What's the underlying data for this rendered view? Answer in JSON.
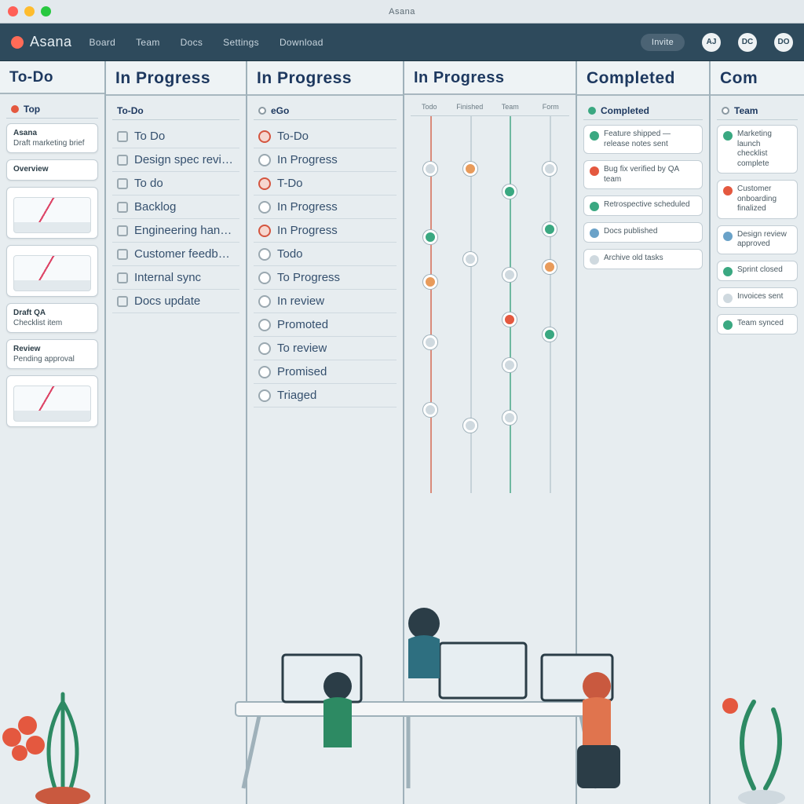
{
  "mac": {
    "title": "Asana"
  },
  "header": {
    "brand": "Asana",
    "nav": [
      "Board",
      "Team",
      "Docs",
      "Settings",
      "Download"
    ],
    "primary_btn": "Invite",
    "circles": [
      "AJ",
      "DC",
      "DO"
    ]
  },
  "columns": [
    {
      "title": "To-Do",
      "section": "Top",
      "cards": [
        {
          "title": "Asana",
          "sub": "Draft marketing brief"
        },
        {
          "title": "Overview",
          "sub": ""
        },
        {
          "title": "",
          "sub": "",
          "thumb": "line"
        },
        {
          "title": "",
          "sub": "",
          "thumb": "line"
        },
        {
          "title": "Draft QA",
          "sub": "Checklist item"
        },
        {
          "title": "Review",
          "sub": "Pending approval"
        },
        {
          "title": "",
          "sub": "",
          "thumb": "line"
        }
      ]
    },
    {
      "title": "In Progress",
      "section": "To-Do",
      "rows": [
        {
          "style": "sq",
          "label": "To Do"
        },
        {
          "style": "sq",
          "label": "Design spec review"
        },
        {
          "style": "sq",
          "label": "To do"
        },
        {
          "style": "sq",
          "label": "Backlog"
        },
        {
          "style": "sq",
          "label": "Engineering handoff"
        },
        {
          "style": "sq",
          "label": "Customer feedback"
        },
        {
          "style": "sq",
          "label": "Internal sync"
        },
        {
          "style": "sq",
          "label": "Docs update"
        }
      ]
    },
    {
      "title": "In Progress",
      "section": "eGo",
      "rows": [
        {
          "style": "red",
          "label": "To-Do"
        },
        {
          "style": "grey",
          "label": "In Progress"
        },
        {
          "style": "red",
          "label": "T-Do"
        },
        {
          "style": "grey",
          "label": "In Progress"
        },
        {
          "style": "red",
          "label": "In Progress"
        },
        {
          "style": "grey",
          "label": "Todo"
        },
        {
          "style": "grey",
          "label": "To Progress"
        },
        {
          "style": "grey",
          "label": "In review"
        },
        {
          "style": "grey",
          "label": "Promoted"
        },
        {
          "style": "grey",
          "label": "To review"
        },
        {
          "style": "grey",
          "label": "Promised"
        },
        {
          "style": "grey",
          "label": "Triaged"
        }
      ]
    },
    {
      "title": "In Progress",
      "lanes": [
        "Todo",
        "Finished",
        "Team",
        "Form"
      ],
      "nodes": [
        {
          "lane": 0,
          "y": 14,
          "c": "grey"
        },
        {
          "lane": 0,
          "y": 32,
          "c": "green"
        },
        {
          "lane": 0,
          "y": 44,
          "c": "orange"
        },
        {
          "lane": 0,
          "y": 60,
          "c": "grey"
        },
        {
          "lane": 0,
          "y": 78,
          "c": "grey"
        },
        {
          "lane": 1,
          "y": 14,
          "c": "orange"
        },
        {
          "lane": 1,
          "y": 38,
          "c": "grey"
        },
        {
          "lane": 1,
          "y": 82,
          "c": "grey"
        },
        {
          "lane": 2,
          "y": 20,
          "c": "green"
        },
        {
          "lane": 2,
          "y": 42,
          "c": "grey"
        },
        {
          "lane": 2,
          "y": 54,
          "c": "red"
        },
        {
          "lane": 2,
          "y": 66,
          "c": "grey"
        },
        {
          "lane": 2,
          "y": 80,
          "c": "grey"
        },
        {
          "lane": 3,
          "y": 14,
          "c": "grey"
        },
        {
          "lane": 3,
          "y": 30,
          "c": "green"
        },
        {
          "lane": 3,
          "y": 40,
          "c": "orange"
        },
        {
          "lane": 3,
          "y": 58,
          "c": "green"
        }
      ]
    },
    {
      "title": "Completed",
      "section": "Completed",
      "minis": [
        {
          "c": "#3aa881",
          "t": "Feature shipped — release notes sent"
        },
        {
          "c": "#e4583f",
          "t": "Bug fix verified by QA team"
        },
        {
          "c": "#3aa881",
          "t": "Retrospective scheduled"
        },
        {
          "c": "#6aa2c8",
          "t": "Docs published"
        },
        {
          "c": "#cfd9df",
          "t": "Archive old tasks"
        }
      ]
    },
    {
      "title": "Com",
      "section": "Team",
      "minis": [
        {
          "c": "#3aa881",
          "t": "Marketing launch checklist complete"
        },
        {
          "c": "#e4583f",
          "t": "Customer onboarding finalized"
        },
        {
          "c": "#6aa2c8",
          "t": "Design review approved"
        },
        {
          "c": "#3aa881",
          "t": "Sprint closed"
        },
        {
          "c": "#cfd9df",
          "t": "Invoices sent"
        },
        {
          "c": "#3aa881",
          "t": "Team synced"
        }
      ]
    }
  ],
  "colors": {
    "accent": "#2e4a5c",
    "red": "#e4583f",
    "green": "#3aa881",
    "orange": "#e89b5b"
  }
}
